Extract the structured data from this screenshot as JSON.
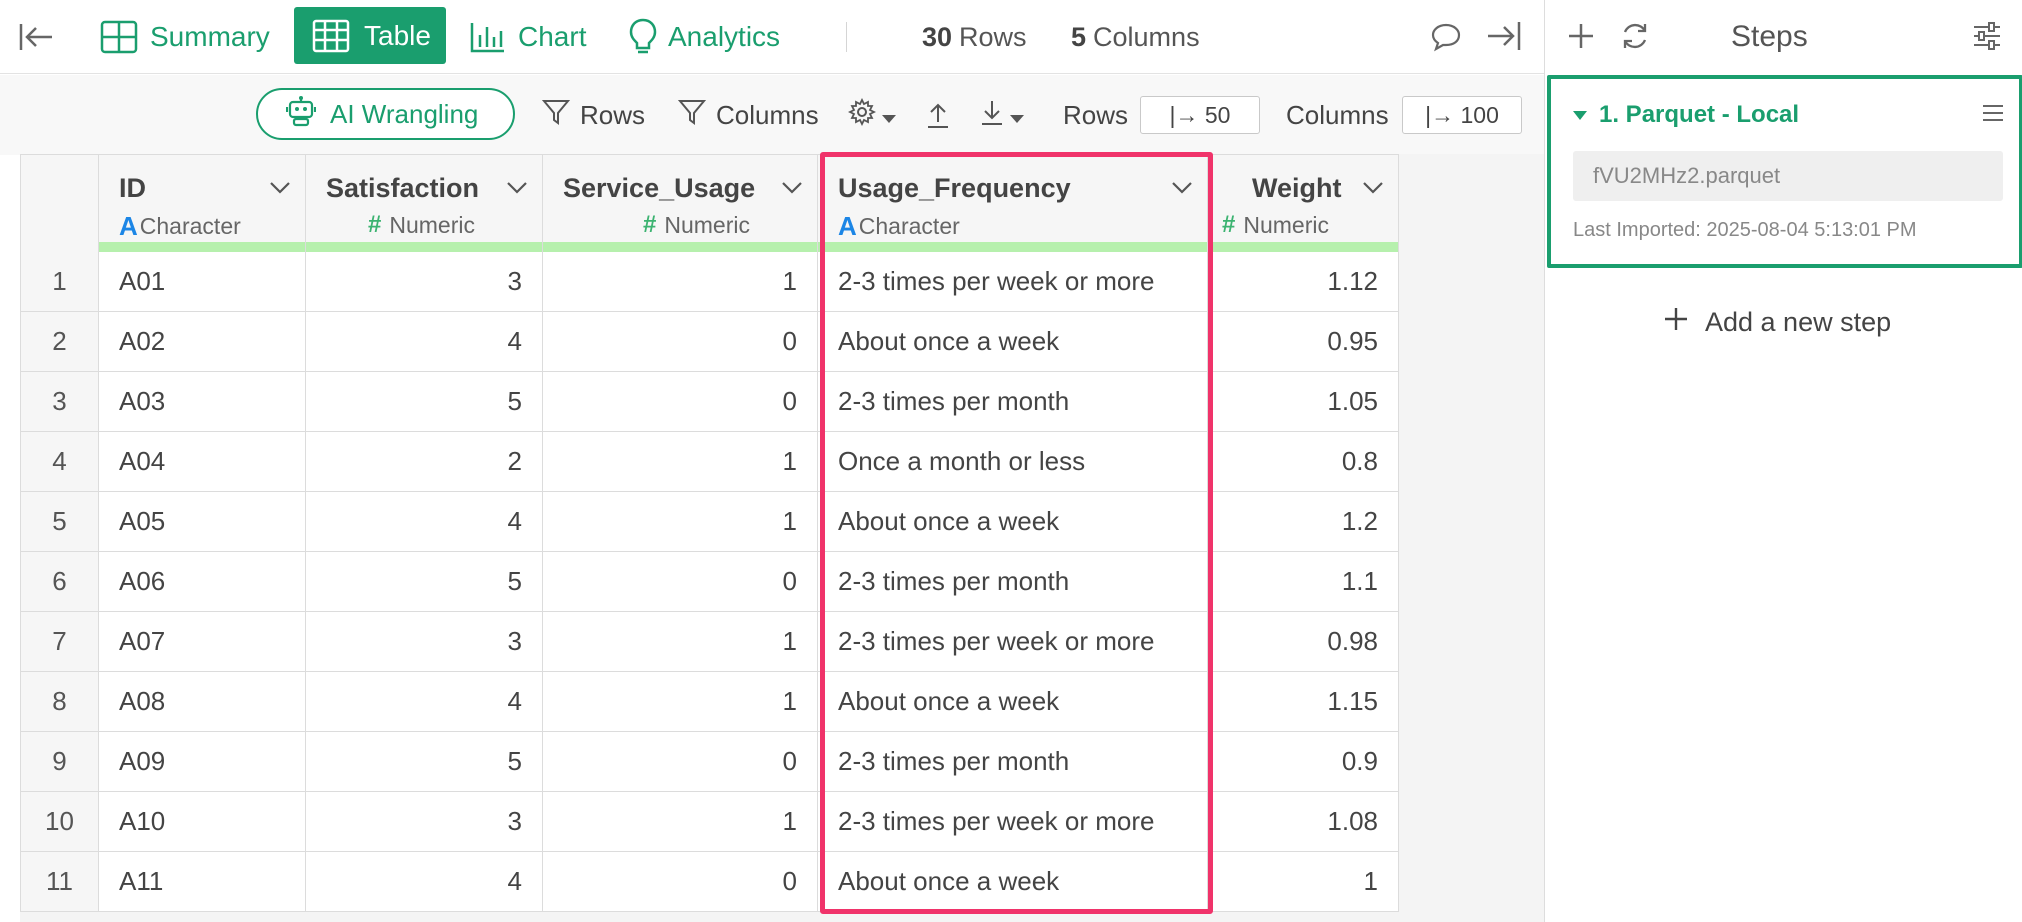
{
  "topbar": {
    "summary_label": "Summary",
    "table_label": "Table",
    "chart_label": "Chart",
    "analytics_label": "Analytics",
    "rows_count": "30",
    "rows_label": "Rows",
    "columns_count": "5",
    "columns_label": "Columns"
  },
  "toolbar": {
    "ai_label": "AI Wrangling",
    "rows_filter_label": "Rows",
    "columns_filter_label": "Columns",
    "rows_label": "Rows",
    "rows_value": "|→ 50",
    "columns_label": "Columns",
    "columns_value": "|→ 100"
  },
  "table": {
    "columns": [
      {
        "name": "ID",
        "type": "Character",
        "type_icon": "A"
      },
      {
        "name": "Satisfaction",
        "type": "Numeric",
        "type_icon": "#"
      },
      {
        "name": "Service_Usage",
        "type": "Numeric",
        "type_icon": "#"
      },
      {
        "name": "Usage_Frequency",
        "type": "Character",
        "type_icon": "A"
      },
      {
        "name": "Weight",
        "type": "Numeric",
        "type_icon": "#"
      }
    ],
    "rows": [
      {
        "n": "1",
        "id": "A01",
        "sat": "3",
        "svc": "1",
        "freq": "2-3 times per week or more",
        "w": "1.12"
      },
      {
        "n": "2",
        "id": "A02",
        "sat": "4",
        "svc": "0",
        "freq": "About once a week",
        "w": "0.95"
      },
      {
        "n": "3",
        "id": "A03",
        "sat": "5",
        "svc": "0",
        "freq": "2-3 times per month",
        "w": "1.05"
      },
      {
        "n": "4",
        "id": "A04",
        "sat": "2",
        "svc": "1",
        "freq": "Once a month or less",
        "w": "0.8"
      },
      {
        "n": "5",
        "id": "A05",
        "sat": "4",
        "svc": "1",
        "freq": "About once a week",
        "w": "1.2"
      },
      {
        "n": "6",
        "id": "A06",
        "sat": "5",
        "svc": "0",
        "freq": "2-3 times per month",
        "w": "1.1"
      },
      {
        "n": "7",
        "id": "A07",
        "sat": "3",
        "svc": "1",
        "freq": "2-3 times per week or more",
        "w": "0.98"
      },
      {
        "n": "8",
        "id": "A08",
        "sat": "4",
        "svc": "1",
        "freq": "About once a week",
        "w": "1.15"
      },
      {
        "n": "9",
        "id": "A09",
        "sat": "5",
        "svc": "0",
        "freq": "2-3 times per month",
        "w": "0.9"
      },
      {
        "n": "10",
        "id": "A10",
        "sat": "3",
        "svc": "1",
        "freq": "2-3 times per week or more",
        "w": "1.08"
      },
      {
        "n": "11",
        "id": "A11",
        "sat": "4",
        "svc": "0",
        "freq": "About once a week",
        "w": "1"
      }
    ]
  },
  "steps": {
    "title": "Steps",
    "step_title": "1. Parquet - Local",
    "file_name": "fVU2MHz2.parquet",
    "last_imported": "Last Imported: 2025-08-04 5:13:01 PM",
    "add_step_label": "Add a new step"
  },
  "colors": {
    "accent": "#1a9e6e",
    "highlight": "#f0336a",
    "quality_bar": "#b6f0ad",
    "character_icon": "#1c86e6",
    "numeric_icon": "#3cb371"
  }
}
